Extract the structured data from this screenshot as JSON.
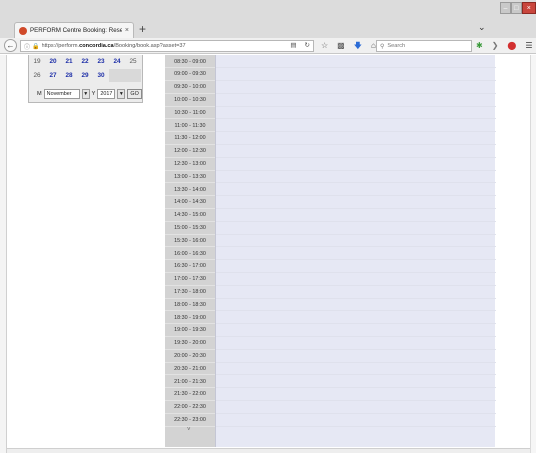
{
  "browser": {
    "tab_title": "PERFORM Centre Booking: Reserve",
    "tab_close": "×",
    "new_tab": "+",
    "url_prefix": "https://perform.",
    "url_domain": "concordia.ca",
    "url_path": "/Booking/book.asp?asset=37",
    "search_placeholder": "Search",
    "colors": {
      "close_button": "#c9463d",
      "secure_lock": "#2a9d3a"
    }
  },
  "calendar": {
    "rows": [
      [
        {
          "text": "19",
          "kind": "plain"
        },
        {
          "text": "20",
          "kind": "link"
        },
        {
          "text": "21",
          "kind": "link"
        },
        {
          "text": "22",
          "kind": "link"
        },
        {
          "text": "23",
          "kind": "link"
        },
        {
          "text": "24",
          "kind": "link"
        },
        {
          "text": "25",
          "kind": "plain"
        }
      ],
      [
        {
          "text": "26",
          "kind": "plain"
        },
        {
          "text": "27",
          "kind": "link"
        },
        {
          "text": "28",
          "kind": "link"
        },
        {
          "text": "29",
          "kind": "link"
        },
        {
          "text": "30",
          "kind": "link"
        },
        {
          "text": "",
          "kind": "blank"
        },
        {
          "text": "",
          "kind": "blank"
        }
      ]
    ],
    "month_label": "M",
    "month_value": "November",
    "year_label": "Y",
    "year_value": "2017",
    "go_label": "GO"
  },
  "schedule": {
    "time_slots": [
      "08:30 - 09:00",
      "09:00 - 09:30",
      "09:30 - 10:00",
      "10:00 - 10:30",
      "10:30 - 11:00",
      "11:00 - 11:30",
      "11:30 - 12:00",
      "12:00 - 12:30",
      "12:30 - 13:00",
      "13:00 - 13:30",
      "13:30 - 14:00",
      "14:00 - 14:30",
      "14:30 - 15:00",
      "15:00 - 15:30",
      "15:30 - 16:00",
      "16:00 - 16:30",
      "16:30 - 17:00",
      "17:00 - 17:30",
      "17:30 - 18:00",
      "18:00 - 18:30",
      "18:30 - 19:00",
      "19:00 - 19:30",
      "19:30 - 20:00",
      "20:00 - 20:30",
      "20:30 - 21:00",
      "21:00 - 21:30",
      "21:30 - 22:00",
      "22:00 - 22:30",
      "22:30 - 23:00"
    ],
    "more_marker": "˅",
    "colors": {
      "time_col": "#d3d3d3",
      "slot_col": "#e6e8f4",
      "date_link": "#1e2fa8"
    }
  }
}
